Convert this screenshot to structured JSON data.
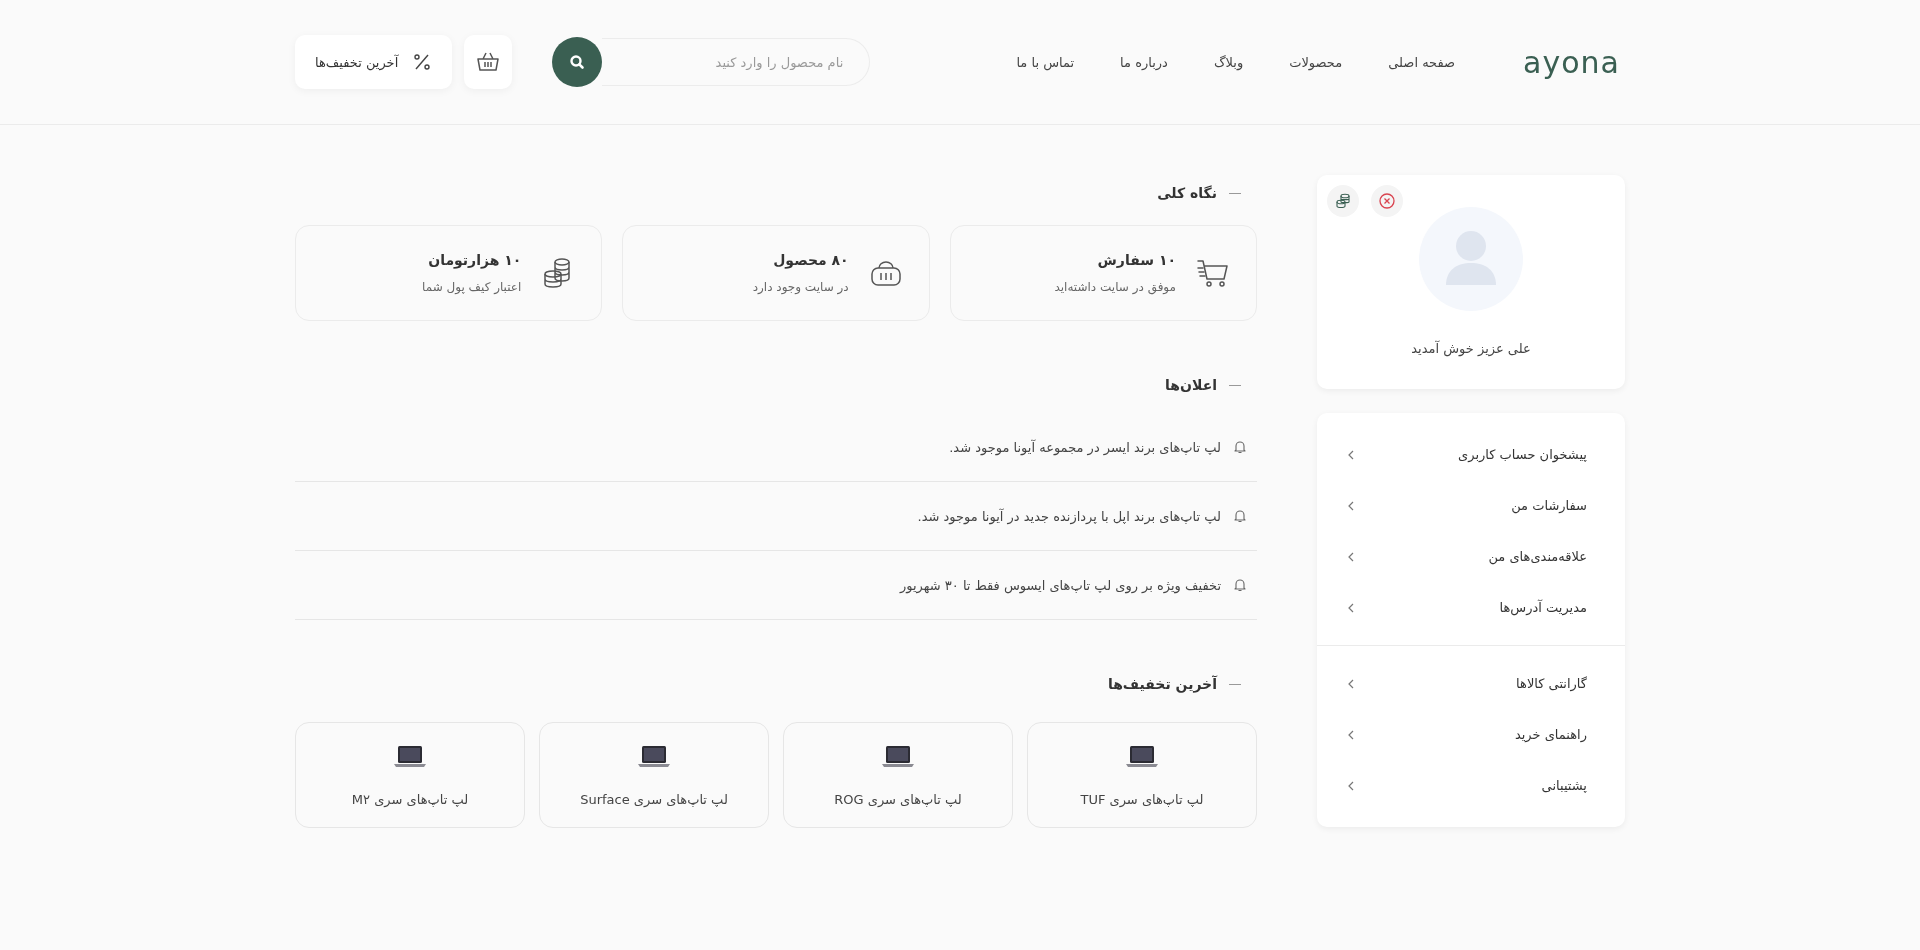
{
  "header": {
    "logo": "ayona",
    "nav": [
      "صفحه اصلی",
      "محصولات",
      "وبلاگ",
      "درباره ما",
      "تماس با ما"
    ],
    "search": {
      "placeholder": "نام محصول را وارد کنید"
    },
    "discounts_button": "آخرین تخفیف‌ها"
  },
  "profile": {
    "greeting": "علی عزیز خوش آمدید"
  },
  "menu": {
    "groups": [
      {
        "items": [
          "پیشخوان حساب کاربری",
          "سفارشات من",
          "علاقه‌مندی‌های من",
          "مدیریت آدرس‌ها"
        ]
      },
      {
        "items": [
          "گارانتی کالاها",
          "راهنمای خرید",
          "پشتیبانی"
        ]
      }
    ]
  },
  "overview": {
    "title": "نگاه کلی",
    "cards": [
      {
        "kind": "cart",
        "value": "۱۰ سفارش",
        "caption": "موفق در سایت داشته‌اید"
      },
      {
        "kind": "basket",
        "value": "۸۰ محصول",
        "caption": "در سایت وجود دارد"
      },
      {
        "kind": "coins",
        "value": "۱۰ هزارتومان",
        "caption": "اعتبار کیف پول شما"
      }
    ]
  },
  "announcements": {
    "title": "اعلان‌ها",
    "items": [
      "لپ تاپ‌های برند ایسر در مجموعه آیونا موجود شد.",
      "لپ تاپ‌های برند اپل با پردازنده جدید در آیونا موجود شد.",
      "تخفیف ویژه بر روی لپ تاپ‌های ایسوس فقط تا ۳۰ شهریور"
    ]
  },
  "discounts": {
    "title": "آخرین تخفیف‌ها",
    "items": [
      "لپ تاپ‌های سری TUF",
      "لپ تاپ‌های سری ROG",
      "لپ تاپ‌های سری Surface",
      "لپ تاپ‌های سری M۲"
    ]
  }
}
